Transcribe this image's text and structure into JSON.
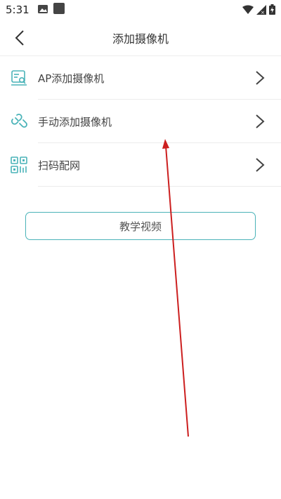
{
  "status_bar": {
    "time": "5:31"
  },
  "header": {
    "title": "添加摄像机",
    "back_icon": "chevron-left-icon"
  },
  "menu": {
    "items": [
      {
        "label": "AP添加摄像机",
        "icon": "ap-camera-icon"
      },
      {
        "label": "手动添加摄像机",
        "icon": "link-icon"
      },
      {
        "label": "扫码配网",
        "icon": "qr-code-icon"
      }
    ]
  },
  "tutorial_button": {
    "label": "教学视频"
  },
  "colors": {
    "accent": "#4ab3b8",
    "annotation_arrow": "#cc1f1f"
  }
}
